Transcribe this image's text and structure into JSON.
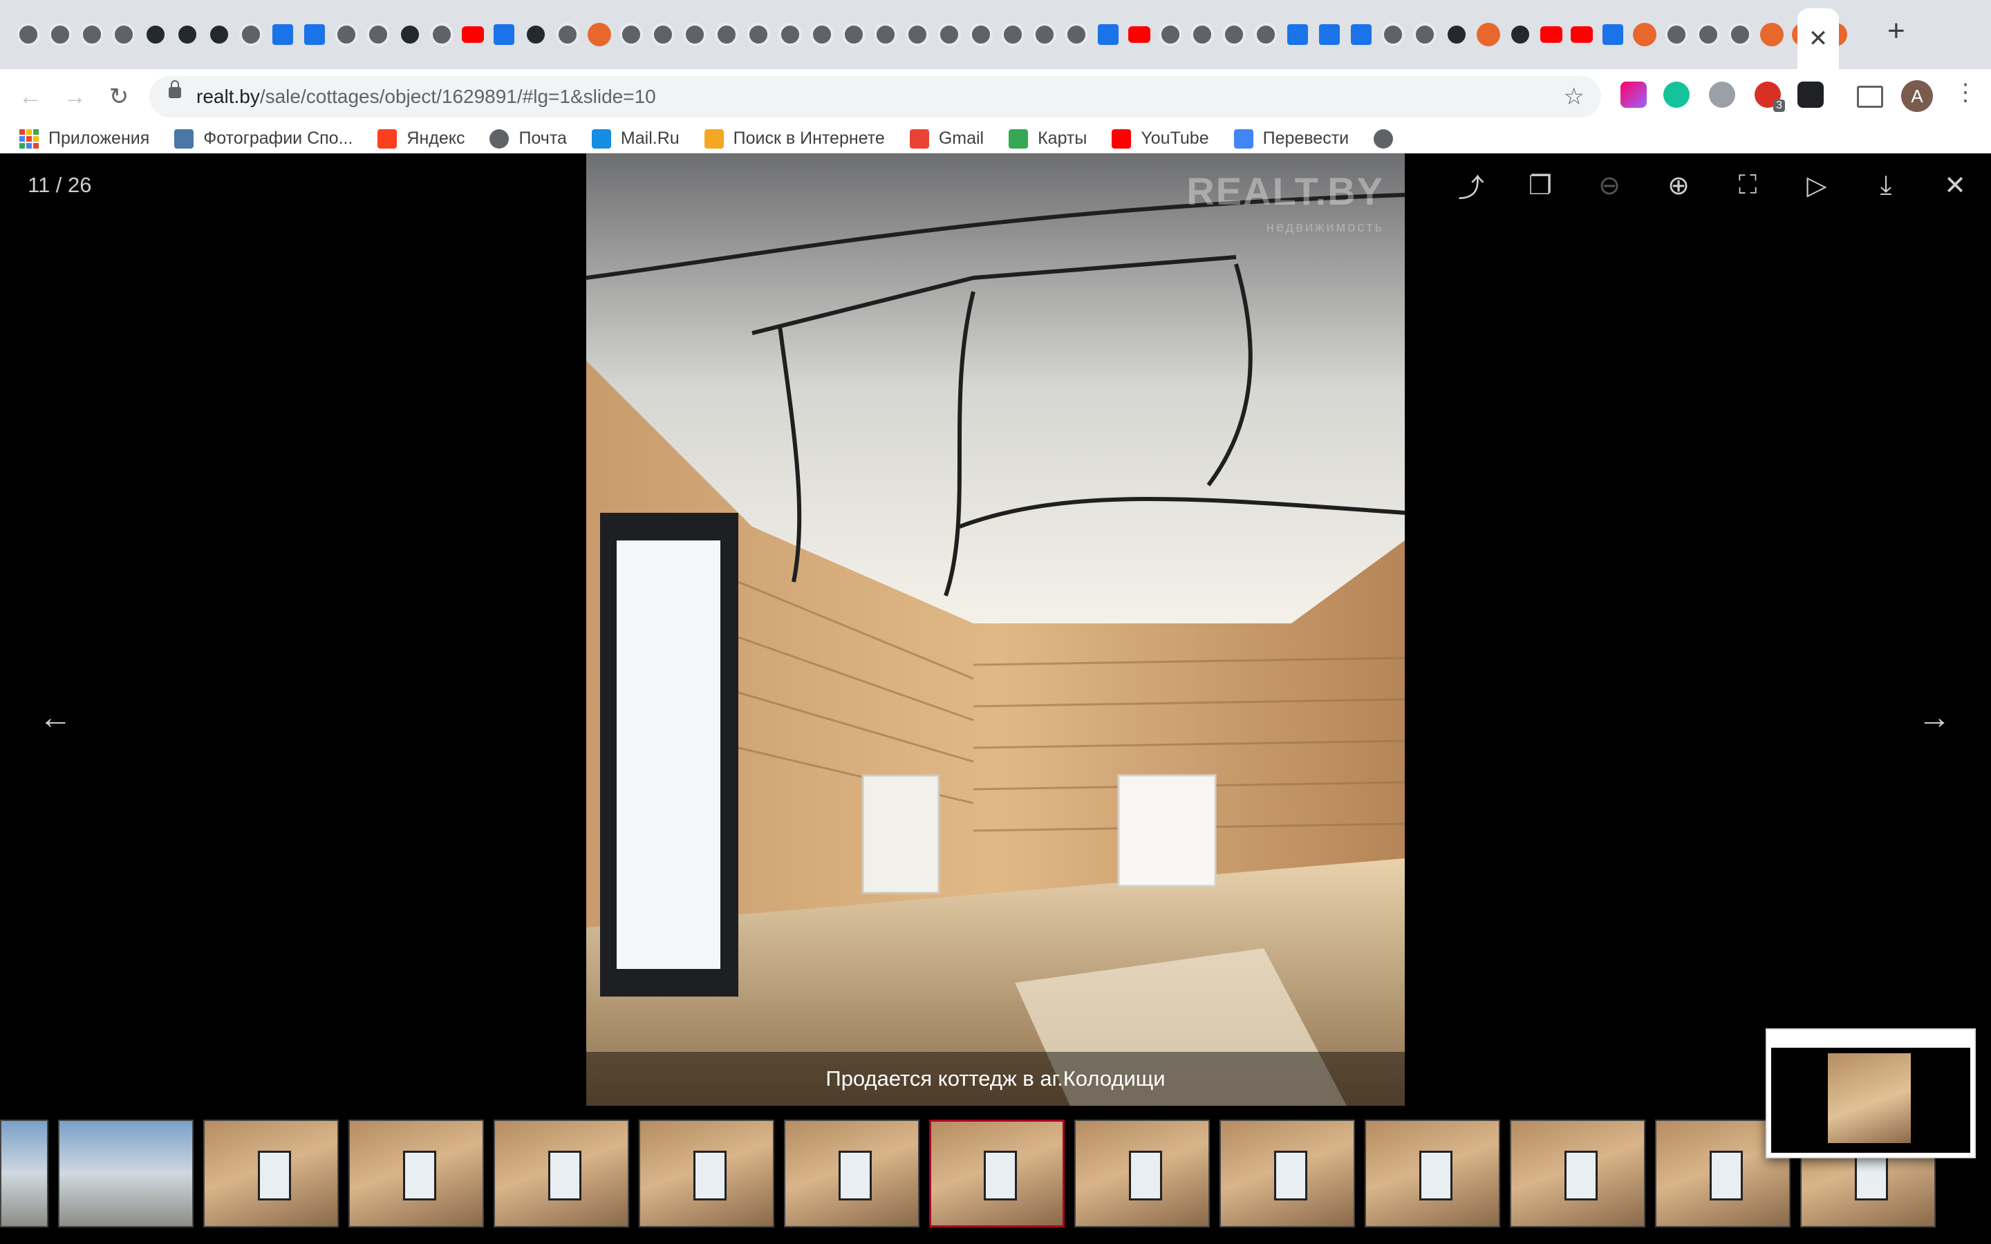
{
  "browser": {
    "tabs_count_visible": 59,
    "active_tab_close": "✕",
    "new_tab": "+",
    "url": {
      "host": "realt.by",
      "path": "/sale/cottages/object/1629891/#lg=1&slide=10"
    },
    "profile_initial": "A",
    "extension_badge": "3"
  },
  "bookmarks": [
    {
      "label": "Приложения",
      "icon": "apps-grid-icon",
      "color": "#ea4335"
    },
    {
      "label": "Фотографии Спо...",
      "icon": "vk-icon",
      "color": "#4a76a8"
    },
    {
      "label": "Яндекс",
      "icon": "yandex-icon",
      "color": "#fc3f1d"
    },
    {
      "label": "Почта",
      "icon": "globe-icon",
      "color": "#5f6368"
    },
    {
      "label": "Mail.Ru",
      "icon": "mailru-icon",
      "color": "#168de2"
    },
    {
      "label": "Поиск в Интернете",
      "icon": "search-web-icon",
      "color": "#f5a623"
    },
    {
      "label": "Gmail",
      "icon": "gmail-icon",
      "color": "#ea4335"
    },
    {
      "label": "Карты",
      "icon": "maps-icon",
      "color": "#34a853"
    },
    {
      "label": "YouTube",
      "icon": "youtube-icon",
      "color": "#ff0000"
    },
    {
      "label": "Перевести",
      "icon": "translate-icon",
      "color": "#4285f4"
    },
    {
      "label": "",
      "icon": "globe-icon",
      "color": "#5f6368"
    }
  ],
  "viewer": {
    "counter": "11 / 26",
    "caption": "Продается коттедж в аг.Колодищи",
    "watermark": "REALT.BY",
    "watermark_sub": "недвижимость",
    "tools": [
      "share-icon",
      "copy-icon",
      "zoom-out-icon",
      "zoom-in-icon",
      "fullscreen-icon",
      "play-icon",
      "download-icon",
      "close-icon"
    ],
    "thumbnails_visible": 14,
    "active_thumbnail": 8
  }
}
